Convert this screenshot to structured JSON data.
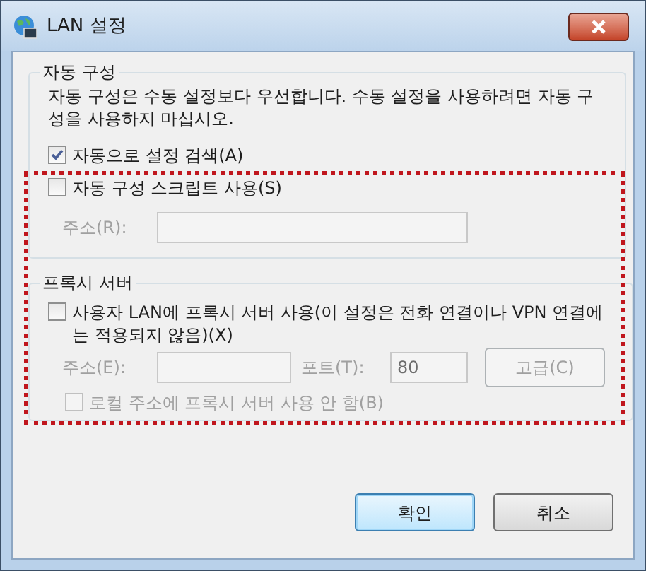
{
  "window": {
    "title": "LAN 설정"
  },
  "auto_config": {
    "title": "자동 구성",
    "description": "자동 구성은 수동 설정보다 우선합니다. 수동 설정을 사용하려면 자동 구성을 사용하지 마십시오.",
    "detect": {
      "label": "자동으로 설정 검색(A)",
      "checked": true,
      "disabled": false
    },
    "script": {
      "label": "자동 구성 스크립트 사용(S)",
      "checked": false,
      "disabled": false
    },
    "address": {
      "label": "주소(R):",
      "disabled": true
    }
  },
  "proxy": {
    "title": "프록시 서버",
    "use_proxy": {
      "label": "사용자 LAN에 프록시 서버 사용(이 설정은 전화 연결이나 VPN 연결에는 적용되지 않음)(X)",
      "checked": false,
      "disabled": false
    },
    "address": {
      "label": "주소(E):",
      "disabled": true
    },
    "port": {
      "label": "포트(T):",
      "value": "80",
      "disabled": true
    },
    "advanced": {
      "label": "고급(C)",
      "disabled": true
    },
    "bypass": {
      "label": "로컬 주소에 프록시 서버 사용 안 함(B)",
      "checked": false,
      "disabled": true
    }
  },
  "buttons": [
    {
      "label": "확인",
      "default": true
    },
    {
      "label": "취소",
      "default": false
    }
  ]
}
